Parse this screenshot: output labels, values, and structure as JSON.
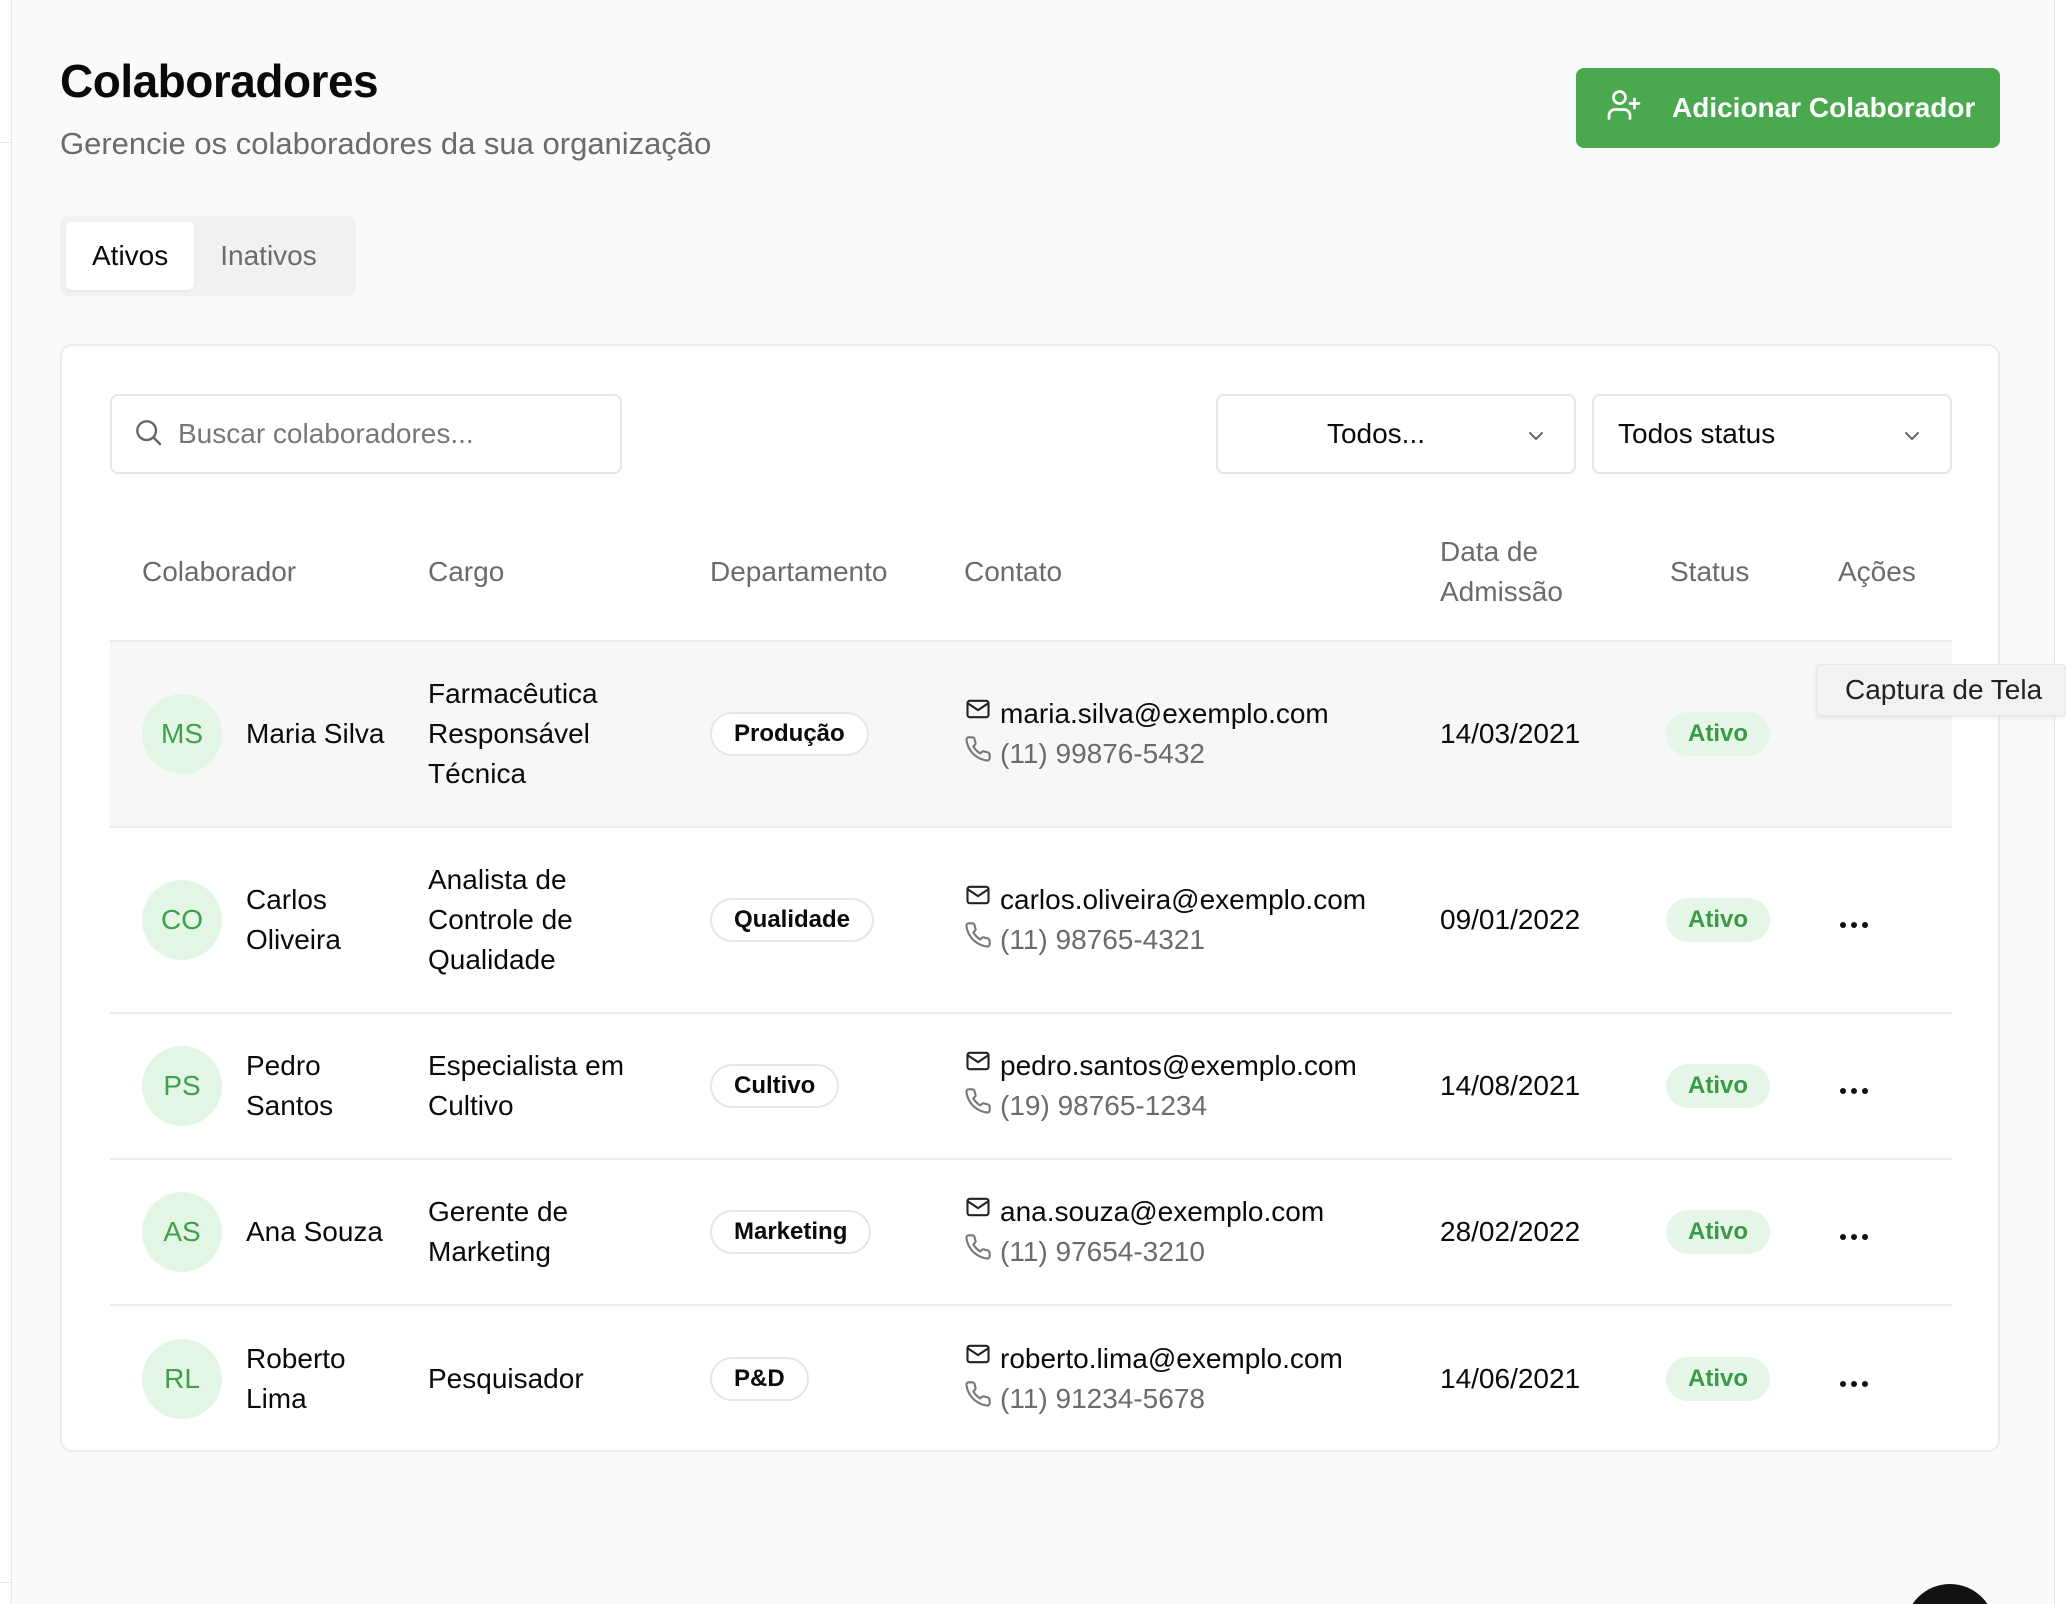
{
  "header": {
    "title": "Colaboradores",
    "subtitle": "Gerencie os colaboradores da sua organização",
    "add_button_label": "Adicionar Colaborador"
  },
  "tabs": [
    {
      "label": "Ativos",
      "active": true
    },
    {
      "label": "Inativos",
      "active": false
    }
  ],
  "filters": {
    "search_placeholder": "Buscar colaboradores...",
    "department_value": "Todos...",
    "status_value": "Todos status"
  },
  "table": {
    "columns": [
      "Colaborador",
      "Cargo",
      "Departamento",
      "Contato",
      "Data de Admissão",
      "Status",
      "Ações"
    ],
    "rows": [
      {
        "initials": "MS",
        "name": "Maria Silva",
        "role": "Farmacêutica Responsável Técnica",
        "department": "Produção",
        "email": "maria.silva@exemplo.com",
        "phone": "(11) 99876-5432",
        "date": "14/03/2021",
        "status": "Ativo"
      },
      {
        "initials": "CO",
        "name": "Carlos Oliveira",
        "role": "Analista de Controle de Qualidade",
        "department": "Qualidade",
        "email": "carlos.oliveira@exemplo.com",
        "phone": "(11) 98765-4321",
        "date": "09/01/2022",
        "status": "Ativo"
      },
      {
        "initials": "PS",
        "name": "Pedro Santos",
        "role": "Especialista em Cultivo",
        "department": "Cultivo",
        "email": "pedro.santos@exemplo.com",
        "phone": "(19) 98765-1234",
        "date": "14/08/2021",
        "status": "Ativo"
      },
      {
        "initials": "AS",
        "name": "Ana Souza",
        "role": "Gerente de Marketing",
        "department": "Marketing",
        "email": "ana.souza@exemplo.com",
        "phone": "(11) 97654-3210",
        "date": "28/02/2022",
        "status": "Ativo"
      },
      {
        "initials": "RL",
        "name": "Roberto Lima",
        "role": "Pesquisador",
        "department": "P&D",
        "email": "roberto.lima@exemplo.com",
        "phone": "(11) 91234-5678",
        "date": "14/06/2021",
        "status": "Ativo"
      }
    ]
  },
  "tooltip": {
    "text": "Captura de Tela"
  },
  "icons": {
    "add_user": "user-plus-icon",
    "search": "search-icon",
    "chevron": "chevron-down-icon",
    "mail": "mail-icon",
    "phone": "phone-icon",
    "more": "more-horizontal-icon"
  },
  "colors": {
    "primary": "#4aa84f",
    "status_bg": "#e5f6e8",
    "status_text": "#3a9a45",
    "avatar_bg": "#e3f6e6",
    "avatar_text": "#3f9f4a"
  }
}
